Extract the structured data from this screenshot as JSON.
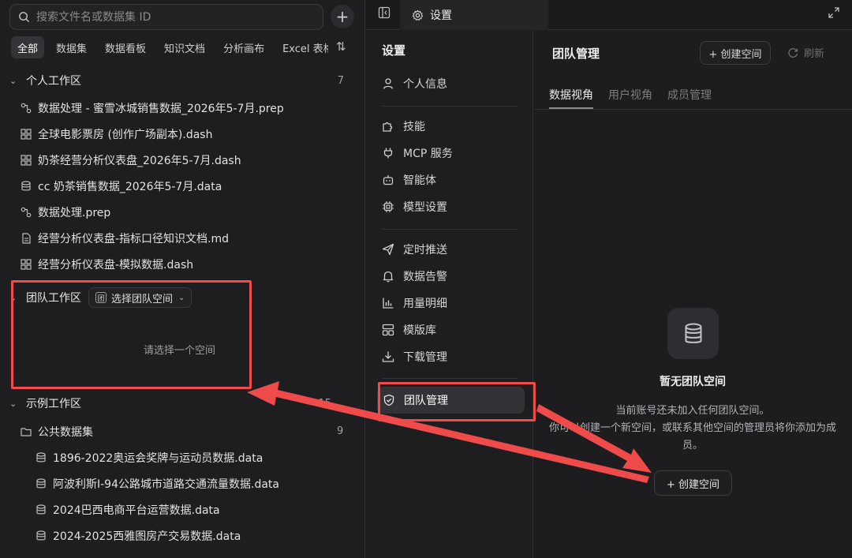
{
  "search": {
    "placeholder": "搜索文件名或数据集 ID"
  },
  "filter_tabs": [
    {
      "label": "全部",
      "active": true
    },
    {
      "label": "数据集"
    },
    {
      "label": "数据看板"
    },
    {
      "label": "知识文档"
    },
    {
      "label": "分析画布"
    },
    {
      "label": "Excel 表格"
    }
  ],
  "personal": {
    "title": "个人工作区",
    "count": "7",
    "files": [
      {
        "icon": "flow-icon",
        "name": "数据处理 - 蜜雪冰城销售数据_2026年5-7月.prep"
      },
      {
        "icon": "dashboard-icon",
        "name": "全球电影票房 (创作广场副本).dash"
      },
      {
        "icon": "dashboard-icon",
        "name": "奶茶经营分析仪表盘_2026年5-7月.dash"
      },
      {
        "icon": "database-icon",
        "name": "cc 奶茶销售数据_2026年5-7月.data"
      },
      {
        "icon": "flow-icon",
        "name": "数据处理.prep"
      },
      {
        "icon": "document-icon",
        "name": "经营分析仪表盘-指标口径知识文档.md"
      },
      {
        "icon": "dashboard-icon",
        "name": "经营分析仪表盘-模拟数据.dash"
      }
    ]
  },
  "team": {
    "title": "团队工作区",
    "select_tag": "团",
    "select_label": "选择团队空间",
    "empty_hint": "请选择一个空间"
  },
  "examples": {
    "title": "示例工作区",
    "count": "15",
    "folder": {
      "name": "公共数据集",
      "count": "9"
    },
    "files": [
      {
        "name": "1896-2022奥运会奖牌与运动员数据.data"
      },
      {
        "name": "阿波利斯I-94公路城市道路交通流量数据.data"
      },
      {
        "name": "2024巴西电商平台运营数据.data"
      },
      {
        "name": "2024-2025西雅图房产交易数据.data"
      }
    ]
  },
  "topbar": {
    "tab_label": "设置"
  },
  "settings_nav": {
    "title": "设置",
    "items": [
      {
        "icon": "user-icon",
        "label": "个人信息"
      },
      {
        "icon": "puzzle-icon",
        "label": "技能"
      },
      {
        "icon": "plug-icon",
        "label": "MCP 服务"
      },
      {
        "icon": "robot-icon",
        "label": "智能体"
      },
      {
        "icon": "chip-icon",
        "label": "模型设置"
      },
      {
        "icon": "send-icon",
        "label": "定时推送"
      },
      {
        "icon": "bell-icon",
        "label": "数据告警"
      },
      {
        "icon": "bar-chart-icon",
        "label": "用量明细"
      },
      {
        "icon": "template-icon",
        "label": "模版库"
      },
      {
        "icon": "download-icon",
        "label": "下载管理"
      },
      {
        "icon": "shield-icon",
        "label": "团队管理",
        "active": true
      }
    ]
  },
  "team_mgmt": {
    "title": "团队管理",
    "create_label": "+ 创建空间",
    "refresh_label": "刷新",
    "subtabs": [
      {
        "label": "数据视角",
        "active": true
      },
      {
        "label": "用户视角"
      },
      {
        "label": "成员管理"
      }
    ],
    "empty_title": "暂无团队空间",
    "empty_desc_1": "当前账号还未加入任何团队空间。",
    "empty_desc_2": "你可以创建一个新空间，或联系其他空间的管理员将你添加为成员。",
    "empty_create_label": "+ 创建空间"
  },
  "colors": {
    "annotation_red": "#ef4b4b",
    "background": "#1d1d1f"
  }
}
